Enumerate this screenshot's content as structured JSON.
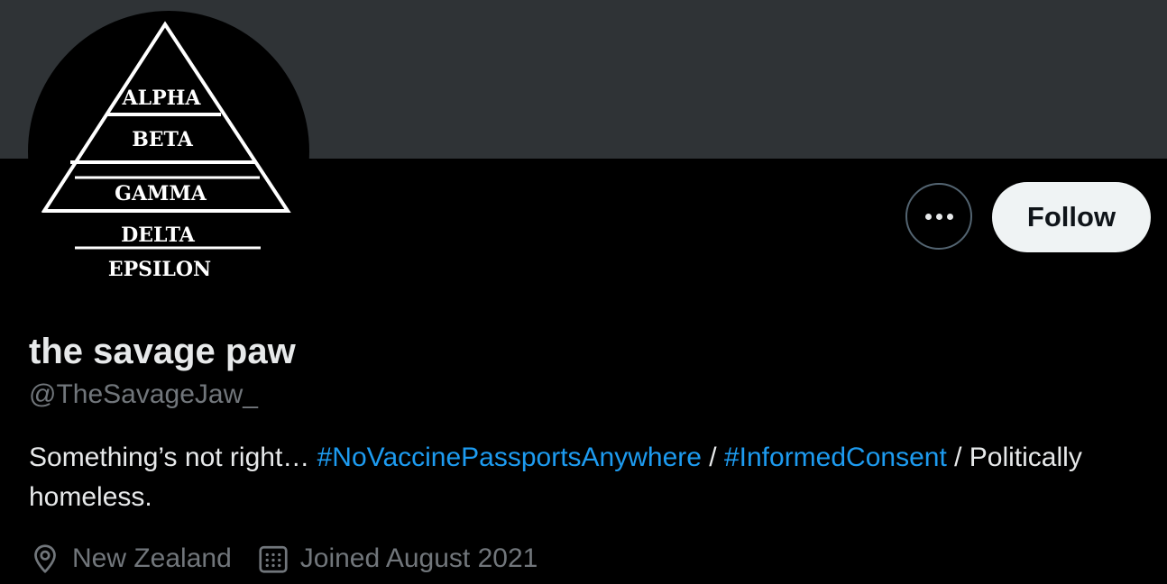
{
  "avatar": {
    "tiers": [
      "ALPHA",
      "BETA",
      "GAMMA",
      "DELTA",
      "EPSILON"
    ]
  },
  "actions": {
    "more_icon": "more-horizontal-icon",
    "follow_label": "Follow"
  },
  "profile": {
    "display_name": "the savage paw",
    "handle": "@TheSavageJaw_",
    "bio": {
      "text_1": "Something’s not right… ",
      "hashtag_1": "#NoVaccinePassportsAnywhere",
      "separator_1": " / ",
      "hashtag_2": "#InformedConsent",
      "text_2": " / Politically homeless."
    },
    "location": "New Zealand",
    "location_icon": "location-pin-icon",
    "joined": "Joined August 2021",
    "joined_icon": "calendar-icon"
  },
  "colors": {
    "background": "#000000",
    "banner": "#2f3336",
    "accent": "#1d9bf0",
    "primary_text": "#e7e9ea",
    "secondary_text": "#71767b",
    "follow_bg": "#eff3f4"
  }
}
